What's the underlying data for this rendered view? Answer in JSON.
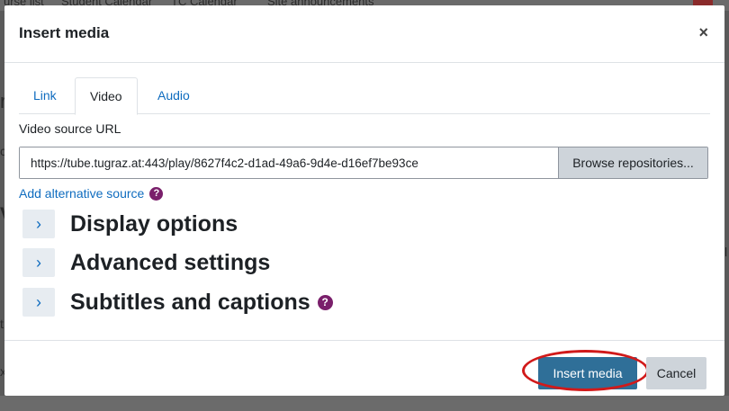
{
  "background": {
    "top_nav": [
      "urse list",
      "Student Calendar",
      "TC Calendar",
      "Site announcements"
    ],
    "edge_fragments": [
      "r",
      "c",
      "V",
      "t",
      "x",
      "l"
    ]
  },
  "modal": {
    "title": "Insert media",
    "close_glyph": "×",
    "tabs": [
      {
        "label": "Link",
        "active": false
      },
      {
        "label": "Video",
        "active": true
      },
      {
        "label": "Audio",
        "active": false
      }
    ],
    "source_label": "Video source URL",
    "source_url": "https://tube.tugraz.at:443/play/8627f4c2-d1ad-49a6-9d4e-d16ef7be93ce",
    "browse_label": "Browse repositories...",
    "alt_source_label": "Add alternative source",
    "help_glyph": "?",
    "sections": [
      {
        "title": "Display options",
        "help": false
      },
      {
        "title": "Advanced settings",
        "help": false
      },
      {
        "title": "Subtitles and captions",
        "help": true
      }
    ],
    "chevron_glyph": "›",
    "insert_label": "Insert media",
    "cancel_label": "Cancel"
  },
  "colors": {
    "link": "#0f6cbf",
    "primary_button": "#2f6f98",
    "help_icon": "#7a1f6b",
    "highlight_ring": "#d11a1a"
  }
}
